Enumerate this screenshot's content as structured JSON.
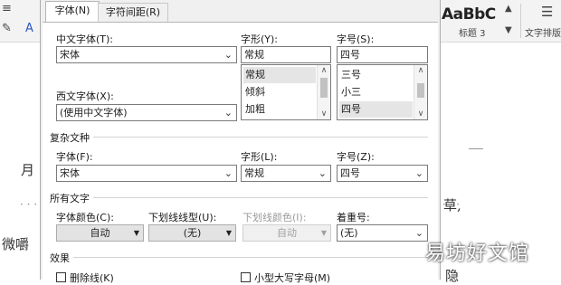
{
  "background": {
    "style_preview": "AaBbC",
    "style_name": "标题 3",
    "layout_label": "文字排版",
    "doc_fragments": [
      "月",
      "草,",
      "微嚼",
      "隐"
    ],
    "dots": [
      "· · ·",
      "· · ·"
    ]
  },
  "dialog": {
    "tabs": [
      "字体(N)",
      "字符间距(R)"
    ],
    "chinese_font": {
      "label": "中文字体(T):",
      "value": "宋体"
    },
    "style": {
      "label": "字形(Y):",
      "value": "常规",
      "options": [
        "常规",
        "倾斜",
        "加粗"
      ],
      "selected": "常规"
    },
    "size": {
      "label": "字号(S):",
      "value": "四号",
      "options": [
        "三号",
        "小三",
        "四号"
      ],
      "selected": "四号"
    },
    "western_font": {
      "label": "西文字体(X):",
      "value": "(使用中文字体)"
    },
    "complex": {
      "section": "复杂文种",
      "font_label": "字体(F):",
      "font_value": "宋体",
      "style_label": "字形(L):",
      "style_value": "常规",
      "size_label": "字号(Z):",
      "size_value": "四号"
    },
    "all_text": {
      "section": "所有文字",
      "color_label": "字体颜色(C):",
      "color_value": "自动",
      "underline_label": "下划线线型(U):",
      "underline_value": "(无)",
      "underline_color_label": "下划线颜色(I):",
      "underline_color_value": "自动",
      "emphasis_label": "着重号:",
      "emphasis_value": "(无)"
    },
    "effects": {
      "section": "效果",
      "strikethrough": "删除线(K)",
      "small_caps": "小型大写字母(M)"
    }
  },
  "watermark": "易坊好文馆"
}
